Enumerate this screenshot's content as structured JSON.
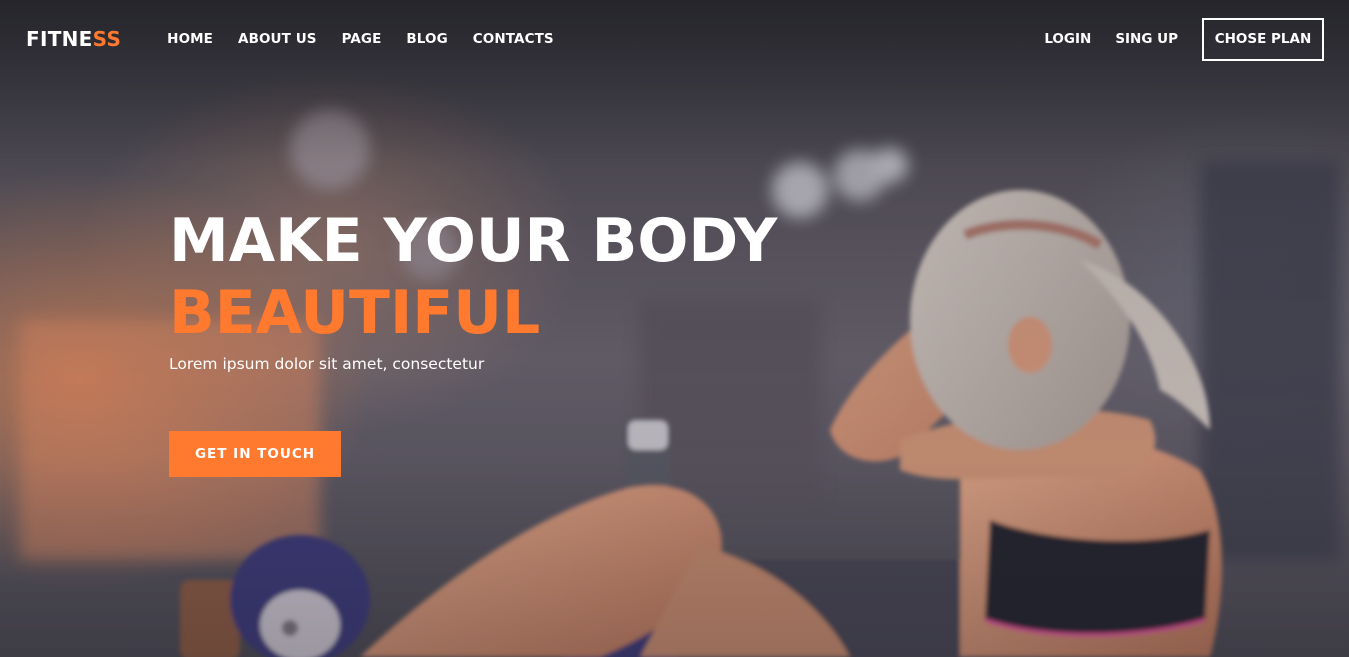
{
  "brand": {
    "logo_main": "FITNE",
    "logo_accent": "SS"
  },
  "nav": {
    "items": [
      "HOME",
      "ABOUT US",
      "PAGE",
      "BLOG",
      "CONTACTS"
    ]
  },
  "header_right": {
    "login": "LOGIN",
    "signup": "SING UP",
    "plan_button": "CHOSE PLAN"
  },
  "hero": {
    "headline_line1": "MAKE YOUR BODY",
    "headline_line2": "BEAUTIFUL",
    "subtitle": "Lorem ipsum dolor sit amet, consectetur",
    "cta_label": "GET IN TOUCH"
  },
  "colors": {
    "accent": "#ff7a2f",
    "text": "#ffffff"
  },
  "background_image": "blurred gym with woman doing sit-ups"
}
